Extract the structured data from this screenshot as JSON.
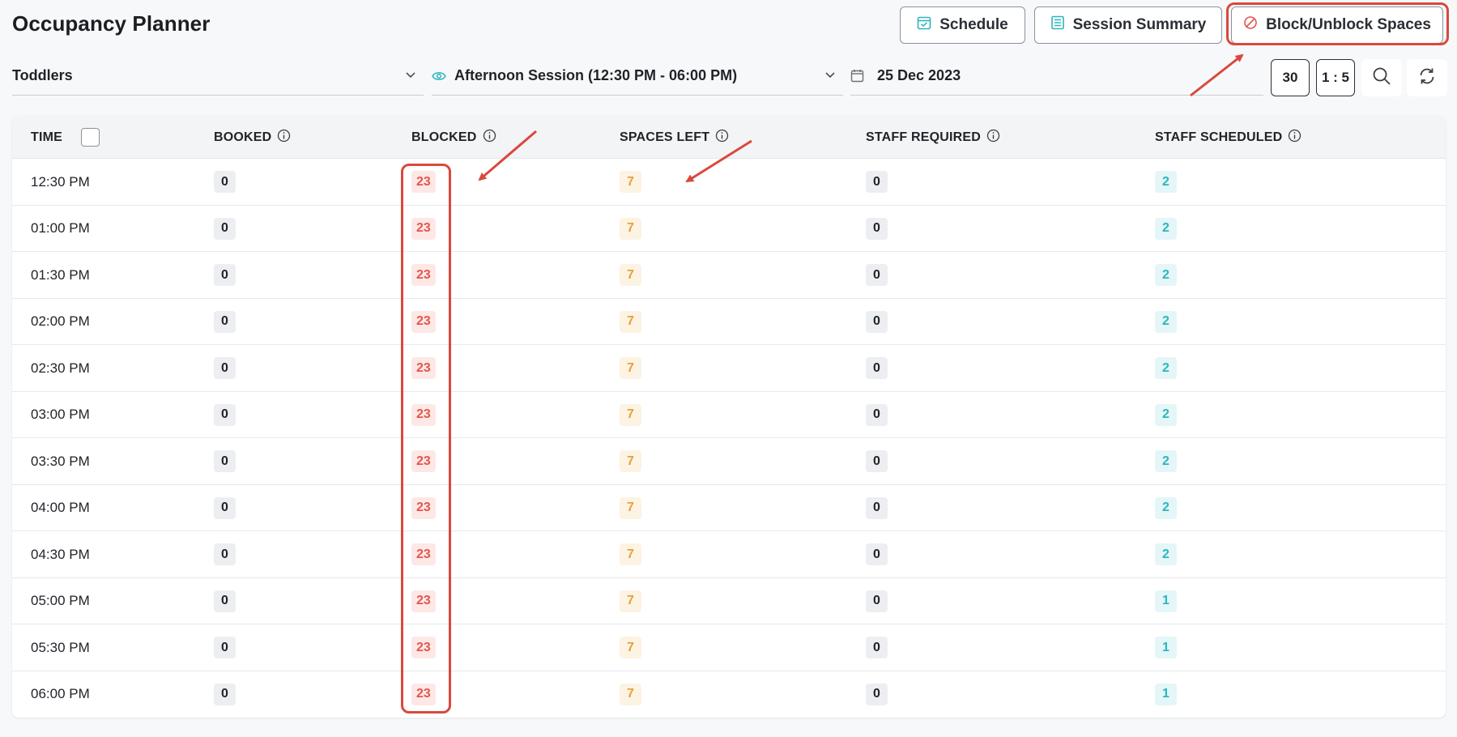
{
  "header": {
    "title": "Occupancy Planner",
    "buttons": {
      "schedule": "Schedule",
      "summary": "Session Summary",
      "block": "Block/Unblock Spaces"
    }
  },
  "filters": {
    "group": "Toddlers",
    "session": "Afternoon Session (12:30 PM - 06:00 PM)",
    "date": "25 Dec 2023",
    "interval": "30",
    "ratio": "1 : 5"
  },
  "table": {
    "columns": {
      "time": "TIME",
      "booked": "BOOKED",
      "blocked": "BLOCKED",
      "spaces": "SPACES LEFT",
      "req": "STAFF REQUIRED",
      "sched": "STAFF SCHEDULED"
    },
    "rows": [
      {
        "time": "12:30 PM",
        "booked": "0",
        "blocked": "23",
        "spaces": "7",
        "req": "0",
        "sched": "2"
      },
      {
        "time": "01:00 PM",
        "booked": "0",
        "blocked": "23",
        "spaces": "7",
        "req": "0",
        "sched": "2"
      },
      {
        "time": "01:30 PM",
        "booked": "0",
        "blocked": "23",
        "spaces": "7",
        "req": "0",
        "sched": "2"
      },
      {
        "time": "02:00 PM",
        "booked": "0",
        "blocked": "23",
        "spaces": "7",
        "req": "0",
        "sched": "2"
      },
      {
        "time": "02:30 PM",
        "booked": "0",
        "blocked": "23",
        "spaces": "7",
        "req": "0",
        "sched": "2"
      },
      {
        "time": "03:00 PM",
        "booked": "0",
        "blocked": "23",
        "spaces": "7",
        "req": "0",
        "sched": "2"
      },
      {
        "time": "03:30 PM",
        "booked": "0",
        "blocked": "23",
        "spaces": "7",
        "req": "0",
        "sched": "2"
      },
      {
        "time": "04:00 PM",
        "booked": "0",
        "blocked": "23",
        "spaces": "7",
        "req": "0",
        "sched": "2"
      },
      {
        "time": "04:30 PM",
        "booked": "0",
        "blocked": "23",
        "spaces": "7",
        "req": "0",
        "sched": "2"
      },
      {
        "time": "05:00 PM",
        "booked": "0",
        "blocked": "23",
        "spaces": "7",
        "req": "0",
        "sched": "1"
      },
      {
        "time": "05:30 PM",
        "booked": "0",
        "blocked": "23",
        "spaces": "7",
        "req": "0",
        "sched": "1"
      },
      {
        "time": "06:00 PM",
        "booked": "0",
        "blocked": "23",
        "spaces": "7",
        "req": "0",
        "sched": "1"
      }
    ]
  },
  "icons": {
    "schedule": "calendar-check-icon",
    "summary": "list-document-icon",
    "block": "block-circle-icon",
    "session": "eye-icon",
    "date": "calendar-icon",
    "dropdown": "chevron-down-icon",
    "info": "info-icon",
    "search": "search-icon",
    "refresh": "refresh-icon"
  },
  "colors": {
    "accent_teal": "#2cb5bd",
    "blocked_red": "#e2574c",
    "spaces_orange": "#e6a03c",
    "annotation_red": "#d8493c"
  }
}
